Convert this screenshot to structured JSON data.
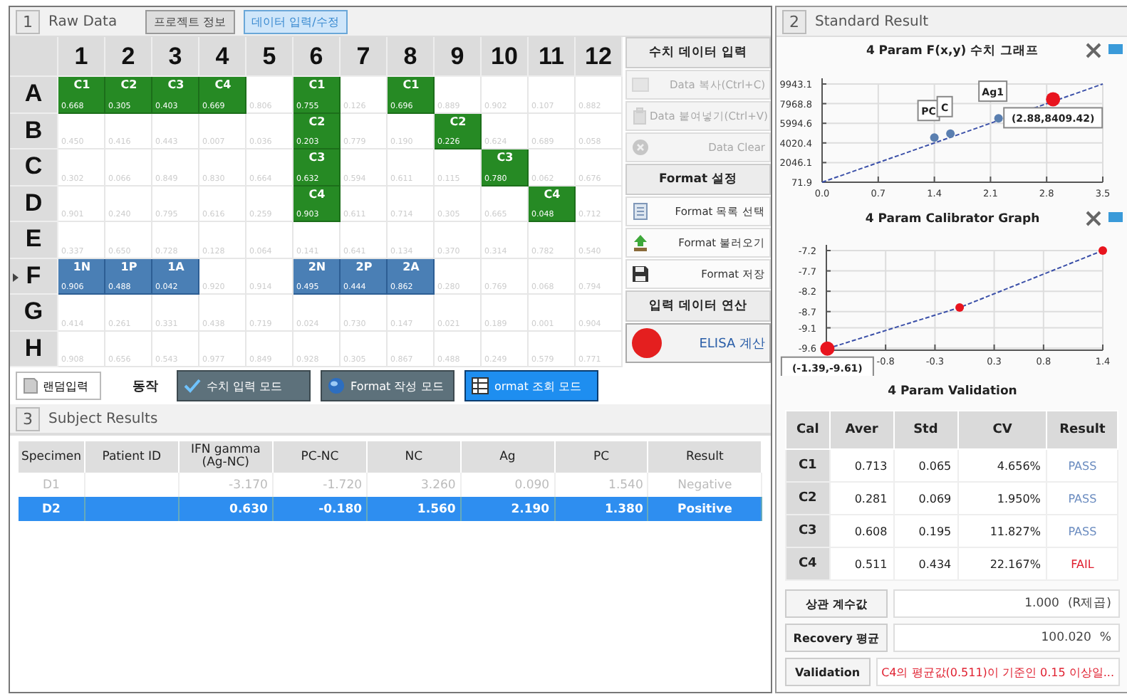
{
  "raw_data": {
    "section_number": "1",
    "title": "Raw Data",
    "tabs": [
      {
        "label": "프로젝트 정보",
        "selected": false
      },
      {
        "label": "데이터 입력/수정",
        "selected": true
      }
    ],
    "columns": [
      "1",
      "2",
      "3",
      "4",
      "5",
      "6",
      "7",
      "8",
      "9",
      "10",
      "11",
      "12"
    ],
    "rows": [
      {
        "label": "A",
        "current": false,
        "cells": [
          {
            "kind": "calibrator",
            "label": "C1",
            "value": "0.668"
          },
          {
            "kind": "calibrator",
            "label": "C2",
            "value": "0.305"
          },
          {
            "kind": "calibrator",
            "label": "C3",
            "value": "0.403"
          },
          {
            "kind": "calibrator",
            "label": "C4",
            "value": "0.669"
          },
          {
            "kind": "empty",
            "value": "0.806"
          },
          {
            "kind": "calibrator",
            "label": "C1",
            "value": "0.755"
          },
          {
            "kind": "empty",
            "value": "0.126"
          },
          {
            "kind": "calibrator",
            "label": "C1",
            "value": "0.696"
          },
          {
            "kind": "empty",
            "value": "0.889"
          },
          {
            "kind": "empty",
            "value": "0.902"
          },
          {
            "kind": "empty",
            "value": "0.107"
          },
          {
            "kind": "empty",
            "value": "0.882"
          }
        ]
      },
      {
        "label": "B",
        "current": false,
        "cells": [
          {
            "kind": "empty",
            "value": "0.450"
          },
          {
            "kind": "empty",
            "value": "0.416"
          },
          {
            "kind": "empty",
            "value": "0.443"
          },
          {
            "kind": "empty",
            "value": "0.007"
          },
          {
            "kind": "empty",
            "value": "0.036"
          },
          {
            "kind": "calibrator",
            "label": "C2",
            "value": "0.203"
          },
          {
            "kind": "empty",
            "value": "0.779"
          },
          {
            "kind": "empty",
            "value": "0.190"
          },
          {
            "kind": "calibrator",
            "label": "C2",
            "value": "0.226"
          },
          {
            "kind": "empty",
            "value": "0.624"
          },
          {
            "kind": "empty",
            "value": "0.689"
          },
          {
            "kind": "empty",
            "value": "0.058"
          }
        ]
      },
      {
        "label": "C",
        "current": false,
        "cells": [
          {
            "kind": "empty",
            "value": "0.302"
          },
          {
            "kind": "empty",
            "value": "0.066"
          },
          {
            "kind": "empty",
            "value": "0.849"
          },
          {
            "kind": "empty",
            "value": "0.830"
          },
          {
            "kind": "empty",
            "value": "0.664"
          },
          {
            "kind": "calibrator",
            "label": "C3",
            "value": "0.632"
          },
          {
            "kind": "empty",
            "value": "0.594"
          },
          {
            "kind": "empty",
            "value": "0.611"
          },
          {
            "kind": "empty",
            "value": "0.115"
          },
          {
            "kind": "calibrator",
            "label": "C3",
            "value": "0.780"
          },
          {
            "kind": "empty",
            "value": "0.062"
          },
          {
            "kind": "empty",
            "value": "0.676"
          }
        ]
      },
      {
        "label": "D",
        "current": false,
        "cells": [
          {
            "kind": "empty",
            "value": "0.901"
          },
          {
            "kind": "empty",
            "value": "0.240"
          },
          {
            "kind": "empty",
            "value": "0.795"
          },
          {
            "kind": "empty",
            "value": "0.616"
          },
          {
            "kind": "empty",
            "value": "0.259"
          },
          {
            "kind": "calibrator",
            "label": "C4",
            "value": "0.903"
          },
          {
            "kind": "empty",
            "value": "0.611"
          },
          {
            "kind": "empty",
            "value": "0.714"
          },
          {
            "kind": "empty",
            "value": "0.305"
          },
          {
            "kind": "empty",
            "value": "0.665"
          },
          {
            "kind": "calibrator",
            "label": "C4",
            "value": "0.048"
          },
          {
            "kind": "empty",
            "value": "0.712"
          }
        ]
      },
      {
        "label": "E",
        "current": false,
        "cells": [
          {
            "kind": "empty",
            "value": "0.337"
          },
          {
            "kind": "empty",
            "value": "0.650"
          },
          {
            "kind": "empty",
            "value": "0.728"
          },
          {
            "kind": "empty",
            "value": "0.128"
          },
          {
            "kind": "empty",
            "value": "0.064"
          },
          {
            "kind": "empty",
            "value": "0.141"
          },
          {
            "kind": "empty",
            "value": "0.641"
          },
          {
            "kind": "empty",
            "value": "0.134"
          },
          {
            "kind": "empty",
            "value": "0.370"
          },
          {
            "kind": "empty",
            "value": "0.314"
          },
          {
            "kind": "empty",
            "value": "0.782"
          },
          {
            "kind": "empty",
            "value": "0.540"
          }
        ]
      },
      {
        "label": "F",
        "current": true,
        "cells": [
          {
            "kind": "sample",
            "label": "1N",
            "value": "0.906"
          },
          {
            "kind": "sample",
            "label": "1P",
            "value": "0.488"
          },
          {
            "kind": "sample",
            "label": "1A",
            "value": "0.042"
          },
          {
            "kind": "empty",
            "value": "0.920"
          },
          {
            "kind": "empty",
            "value": "0.914"
          },
          {
            "kind": "sample",
            "label": "2N",
            "value": "0.495"
          },
          {
            "kind": "sample",
            "label": "2P",
            "value": "0.444"
          },
          {
            "kind": "sample",
            "label": "2A",
            "value": "0.862"
          },
          {
            "kind": "empty",
            "value": "0.280"
          },
          {
            "kind": "empty",
            "value": "0.769"
          },
          {
            "kind": "empty",
            "value": "0.068"
          },
          {
            "kind": "empty",
            "value": "0.794"
          }
        ]
      },
      {
        "label": "G",
        "current": false,
        "cells": [
          {
            "kind": "empty",
            "value": "0.414"
          },
          {
            "kind": "empty",
            "value": "0.261"
          },
          {
            "kind": "empty",
            "value": "0.331"
          },
          {
            "kind": "empty",
            "value": "0.438"
          },
          {
            "kind": "empty",
            "value": "0.719"
          },
          {
            "kind": "empty",
            "value": "0.024"
          },
          {
            "kind": "empty",
            "value": "0.730"
          },
          {
            "kind": "empty",
            "value": "0.147"
          },
          {
            "kind": "empty",
            "value": "0.021"
          },
          {
            "kind": "empty",
            "value": "0.189"
          },
          {
            "kind": "empty",
            "value": "0.001"
          },
          {
            "kind": "empty",
            "value": "0.904"
          }
        ]
      },
      {
        "label": "H",
        "current": false,
        "cells": [
          {
            "kind": "empty",
            "value": "0.908"
          },
          {
            "kind": "empty",
            "value": "0.656"
          },
          {
            "kind": "empty",
            "value": "0.543"
          },
          {
            "kind": "empty",
            "value": "0.977"
          },
          {
            "kind": "empty",
            "value": "0.849"
          },
          {
            "kind": "empty",
            "value": "0.928"
          },
          {
            "kind": "empty",
            "value": "0.305"
          },
          {
            "kind": "empty",
            "value": "0.867"
          },
          {
            "kind": "empty",
            "value": "0.488"
          },
          {
            "kind": "empty",
            "value": "0.249"
          },
          {
            "kind": "empty",
            "value": "0.579"
          },
          {
            "kind": "empty",
            "value": "0.771"
          }
        ]
      }
    ],
    "actions": [
      {
        "kind": "header",
        "label": "수치 데이터 입력"
      },
      {
        "kind": "copy",
        "label": "Data 복사(Ctrl+C)",
        "disabled": true
      },
      {
        "kind": "paste",
        "label": "Data 붙여넣기(Ctrl+V)",
        "disabled": true
      },
      {
        "kind": "clear",
        "label": "Data Clear",
        "disabled": true
      },
      {
        "kind": "header",
        "label": "Format 설정"
      },
      {
        "kind": "list",
        "label": "Format 목록 선택",
        "disabled": false
      },
      {
        "kind": "load",
        "label": "Format 불러오기",
        "disabled": false
      },
      {
        "kind": "save",
        "label": "Format 저장",
        "disabled": false
      },
      {
        "kind": "header",
        "label": "입력 데이터 연산"
      },
      {
        "kind": "run",
        "label": "ELISA 계산",
        "disabled": false
      }
    ]
  },
  "toolbar": {
    "random_button": "랜덤입력",
    "label": "동작",
    "modes": [
      {
        "kind": "check",
        "label": "수치 입력 모드",
        "selected": false
      },
      {
        "kind": "globe",
        "label": "Format 작성 모드",
        "selected": false
      },
      {
        "kind": "grid",
        "label": "ormat 조회 모드",
        "selected": true
      }
    ]
  },
  "subject_results": {
    "section_number": "3",
    "title": "Subject Results",
    "columns": [
      "Specimen",
      "Patient ID",
      "IFN gamma\n(Ag-NC)",
      "PC-NC",
      "NC",
      "Ag",
      "PC",
      "Result"
    ],
    "rows": [
      {
        "specimen": "D1",
        "ifn_gamma": "-3.170",
        "pc_nc": "-1.720",
        "nc": "3.260",
        "ag": "0.090",
        "pc": "1.540",
        "result": "Negative",
        "selected": false
      },
      {
        "specimen": "D2",
        "ifn_gamma": "0.630",
        "pc_nc": "-0.180",
        "nc": "1.560",
        "ag": "2.190",
        "pc": "1.380",
        "result": "Positive",
        "selected": true
      }
    ]
  },
  "standard_result": {
    "section_number": "2",
    "title": "Standard Result",
    "charts": [
      {
        "chart_data": {
          "type": "line",
          "title": "4 Param F(x,y) 수치 그래프",
          "x": [
            0,
            1.4,
            1.6,
            2.2,
            2.88,
            3.5
          ],
          "xlim": [
            0,
            3.5
          ],
          "ylim": [
            71.9,
            9943.1
          ],
          "xticks": [
            {
              "value": 0,
              "label": "0.0"
            },
            {
              "value": 0.7,
              "label": "0.7"
            },
            {
              "value": 1.4,
              "label": "1.4"
            },
            {
              "value": 2.1,
              "label": "2.1"
            },
            {
              "value": 2.8,
              "label": "2.8"
            },
            {
              "value": 3.5,
              "label": "3.5"
            }
          ],
          "yticks": [
            {
              "value": 71.9,
              "label": "71.9"
            },
            {
              "value": 2046.1,
              "label": "2046.1"
            },
            {
              "value": 4020.4,
              "label": "4020.4"
            },
            {
              "value": 5994.6,
              "label": "5994.6"
            },
            {
              "value": 7968.8,
              "label": "7968.8"
            },
            {
              "value": 9943.1,
              "label": "9943.1"
            }
          ],
          "grid": true,
          "series": [
            {
              "color": "#3a4fa8",
              "line_style": "dashed",
              "values": [
                71.9,
                4020,
                4580,
                6280,
                8190,
                9943.1
              ]
            },
            {
              "color": "#5a7fb0",
              "type": "scatter",
              "marker": "circle",
              "values": [
                null,
                4560,
                4950,
                6500,
                null,
                null
              ]
            },
            {
              "color": "#e8141e",
              "type": "scatter",
              "marker": "large_circle",
              "values": [
                null,
                null,
                null,
                null,
                8409.42,
                null
              ]
            }
          ],
          "annotations": [
            {
              "text": "PC",
              "x": 1.4,
              "y": 4560
            },
            {
              "text": "C",
              "x": 1.6,
              "y": 4950
            },
            {
              "text": "Ag1",
              "x": 2.2,
              "y": 6500
            },
            {
              "text": "(2.88,8409.42)",
              "x": 2.88,
              "y": 8409.42
            }
          ]
        }
      },
      {
        "chart_data": {
          "type": "line",
          "title": "4 Param Calibrator Graph",
          "x": [
            -1.39,
            -0.05,
            1.4
          ],
          "xlim": [
            -1.4,
            1.4
          ],
          "ylim": [
            -9.65,
            -7.2
          ],
          "grid": true,
          "xticks": [
            {
              "value": -0.8,
              "label": "-0.8"
            },
            {
              "value": -0.3,
              "label": "-0.3"
            },
            {
              "value": 0.3,
              "label": "0.3"
            },
            {
              "value": 0.8,
              "label": "0.8"
            },
            {
              "value": 1.4,
              "label": "1.4"
            }
          ],
          "yticks": [
            {
              "value": -7.2,
              "label": "-7.2"
            },
            {
              "value": -7.7,
              "label": "-7.7"
            },
            {
              "value": -8.2,
              "label": "-8.2"
            },
            {
              "value": -8.7,
              "label": "-8.7"
            },
            {
              "value": -9.1,
              "label": "-9.1"
            },
            {
              "value": -9.6,
              "label": "-9.6"
            }
          ],
          "series": [
            {
              "color": "#3a4fa8",
              "line_style": "dashed",
              "values": [
                -9.61,
                -8.6,
                -7.2
              ]
            },
            {
              "color": "#e8141e",
              "type": "scatter",
              "marker": "circle",
              "values": [
                null,
                -8.6,
                -7.2
              ]
            },
            {
              "color": "#e8141e",
              "type": "scatter",
              "marker": "large_circle",
              "values": [
                -9.61,
                null,
                null
              ]
            }
          ],
          "annotations": [
            {
              "text": "(-1.39,-9.61)",
              "x": -1.39,
              "y": -9.61
            }
          ]
        }
      }
    ],
    "validation_title": "4 Param Validation",
    "cal_table": {
      "columns": [
        "Cal",
        "Aver",
        "Std",
        "CV",
        "Result"
      ],
      "rows": [
        {
          "cal": "C1",
          "aver": "0.713",
          "std": "0.065",
          "cv": "4.656%",
          "result": "PASS",
          "pass": true
        },
        {
          "cal": "C2",
          "aver": "0.281",
          "std": "0.069",
          "cv": "1.950%",
          "result": "PASS",
          "pass": true
        },
        {
          "cal": "C3",
          "aver": "0.608",
          "std": "0.195",
          "cv": "11.827%",
          "result": "PASS",
          "pass": true
        },
        {
          "cal": "C4",
          "aver": "0.511",
          "std": "0.434",
          "cv": "22.167%",
          "result": "FAIL",
          "pass": false
        }
      ]
    },
    "summary": [
      {
        "label": "상관 계수값",
        "value": "1.000",
        "unit": "(R제곱)",
        "alert": false
      },
      {
        "label": "Recovery 평균",
        "value": "100.020",
        "unit": "%",
        "alert": false
      },
      {
        "label": "Validation",
        "value": "C4의 평균값(0.511)이 기준인 0.15 이상일...",
        "alert": true
      }
    ]
  }
}
